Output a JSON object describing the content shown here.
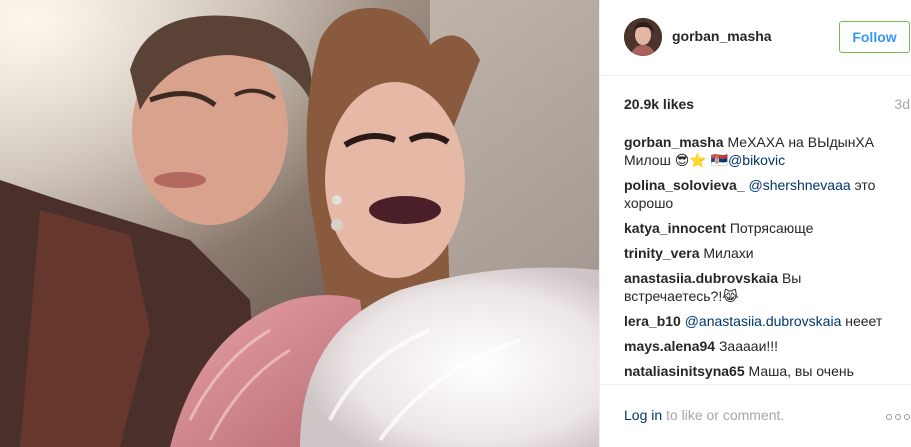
{
  "post": {
    "username": "gorban_masha",
    "follow_label": "Follow",
    "likes": "20.9k likes",
    "time_ago": "3d"
  },
  "comments": [
    {
      "author": "gorban_masha",
      "parts": [
        {
          "t": "text",
          "v": " МеХАХА на ВЫдынХА Милош 😎⭐ 🇷🇸"
        },
        {
          "t": "mention",
          "v": "@bikovic"
        }
      ]
    },
    {
      "author": "polina_solovieva_",
      "parts": [
        {
          "t": "text",
          "v": " "
        },
        {
          "t": "mention",
          "v": "@shershnevaaa"
        },
        {
          "t": "text",
          "v": " это хорошо"
        }
      ]
    },
    {
      "author": "katya_innocent",
      "parts": [
        {
          "t": "text",
          "v": " Потрясающе"
        }
      ]
    },
    {
      "author": "trinity_vera",
      "parts": [
        {
          "t": "text",
          "v": " Милахи"
        }
      ]
    },
    {
      "author": "anastasiia.dubrovskaia",
      "parts": [
        {
          "t": "text",
          "v": " Вы встречаетесь?!😹"
        }
      ]
    },
    {
      "author": "lera_b10",
      "parts": [
        {
          "t": "text",
          "v": " "
        },
        {
          "t": "mention",
          "v": "@anastasiia.dubrovskaia"
        },
        {
          "t": "text",
          "v": " нееет"
        }
      ]
    },
    {
      "author": "mays.alena94",
      "parts": [
        {
          "t": "text",
          "v": " Зааааи!!!"
        }
      ]
    },
    {
      "author": "nataliasinitsyna65",
      "parts": [
        {
          "t": "text",
          "v": " Маша, вы очень"
        }
      ]
    }
  ],
  "footer": {
    "login_link": "Log in",
    "login_rest": " to like or comment."
  },
  "colors": {
    "follow_border": "#70c050",
    "follow_text": "#3897f0",
    "link": "#003569",
    "muted": "#a5a7aa"
  },
  "icons": {
    "more": "more-options-icon"
  }
}
